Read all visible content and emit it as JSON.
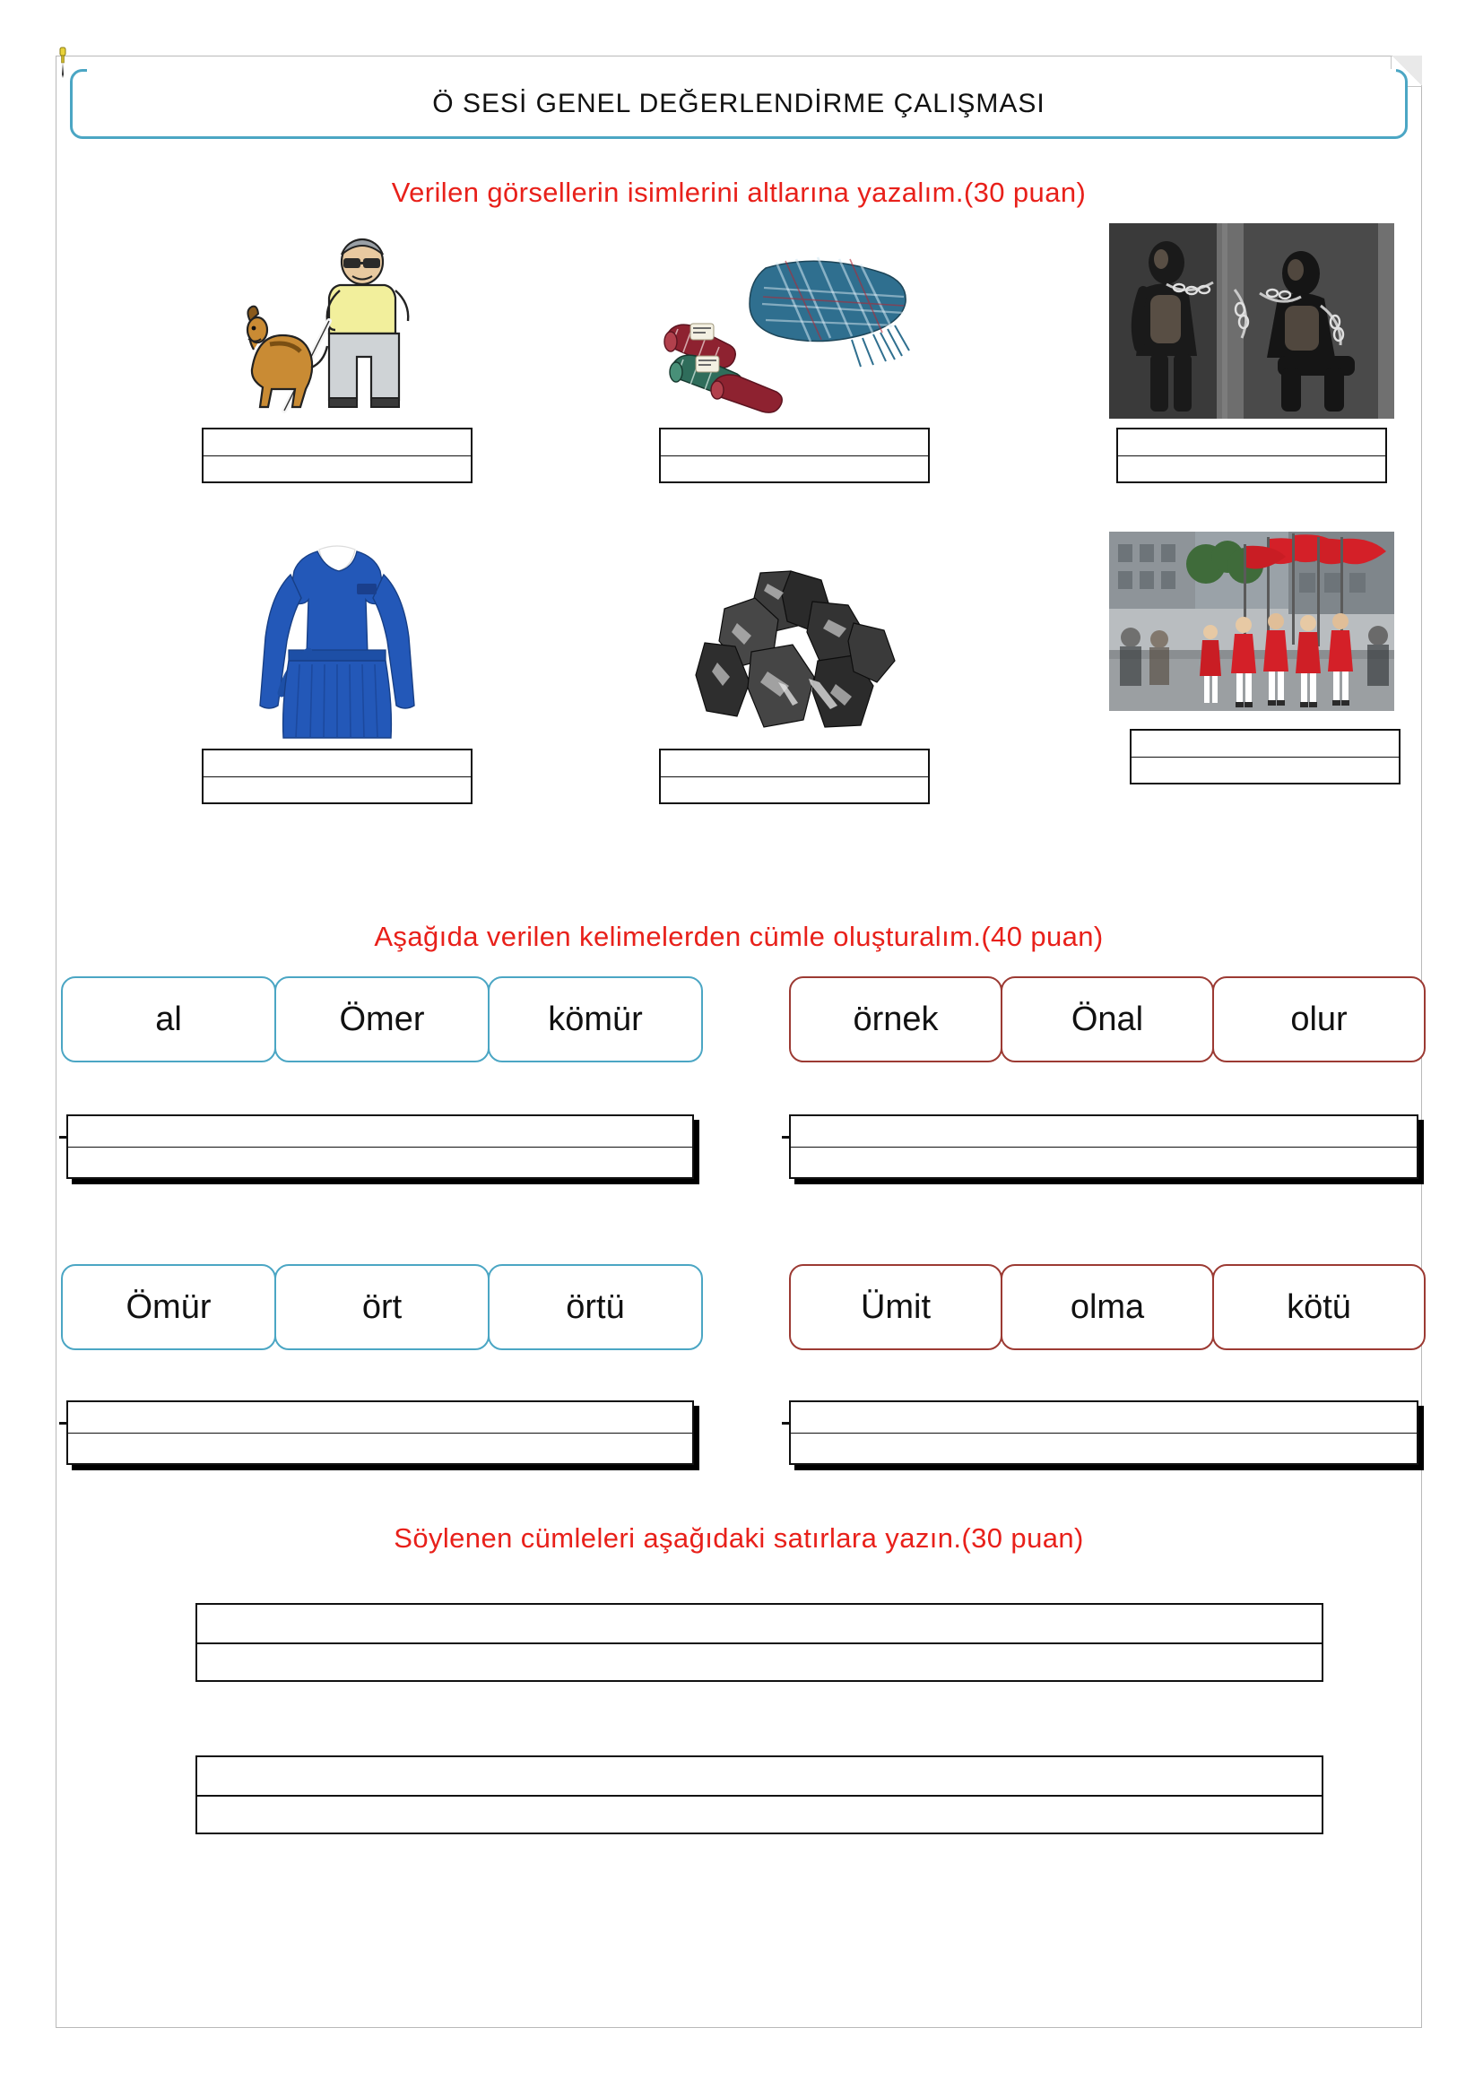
{
  "document": {
    "title": "Ö SESİ GENEL DEĞERLENDİRME ÇALIŞMASI",
    "language": "tr"
  },
  "sections": {
    "pictures": {
      "instruction": "Verilen görsellerin isimlerini altlarına yazalım.(30 puan)",
      "points": "30 puan",
      "items": [
        {
          "id": "pic-1",
          "image_name": "blind-man-with-guide-dog",
          "answer": ""
        },
        {
          "id": "pic-2",
          "image_name": "rolled-scarves-shawls",
          "answer": ""
        },
        {
          "id": "pic-3",
          "image_name": "enslaved-people-in-chains",
          "answer": ""
        },
        {
          "id": "pic-4",
          "image_name": "blue-school-uniform-dress",
          "answer": ""
        },
        {
          "id": "pic-5",
          "image_name": "coal-lumps",
          "answer": ""
        },
        {
          "id": "pic-6",
          "image_name": "flag-ceremony-parade",
          "answer": ""
        }
      ]
    },
    "sentences": {
      "instruction": "Aşağıda verilen kelimelerden cümle oluşturalım.(40 puan)",
      "points": "40 puan",
      "groups": [
        {
          "id": "group-1",
          "color": "#4ba6c4",
          "words": [
            "al",
            "Ömer",
            "kömür"
          ],
          "answer": ""
        },
        {
          "id": "group-2",
          "color": "#9c3a33",
          "words": [
            "örnek",
            "Önal",
            "olur"
          ],
          "answer": ""
        },
        {
          "id": "group-3",
          "color": "#4ba6c4",
          "words": [
            "Ömür",
            "ört",
            "örtü"
          ],
          "answer": ""
        },
        {
          "id": "group-4",
          "color": "#9c3a33",
          "words": [
            "Ümit",
            "olma",
            "kötü"
          ],
          "answer": ""
        }
      ]
    },
    "dictation": {
      "instruction": "Söylenen cümleleri aşağıdaki satırlara yazın.(30 puan)",
      "points": "30 puan",
      "lines": [
        {
          "id": "dictation-1",
          "answer": ""
        },
        {
          "id": "dictation-2",
          "answer": ""
        }
      ]
    }
  },
  "colors": {
    "accent_blue": "#4ba6c4",
    "accent_red": "#9c3a33",
    "instruction_red": "#e8201a",
    "ink": "#111111",
    "page_border": "#b9b9b9"
  }
}
